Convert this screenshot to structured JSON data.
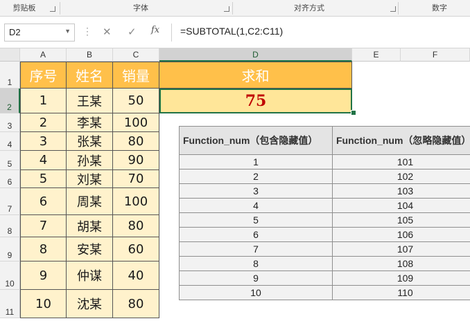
{
  "ribbon": {
    "groups": [
      "剪贴板",
      "字体",
      "对齐方式",
      "数字"
    ]
  },
  "formula_bar": {
    "name_box": "D2",
    "cancel_icon": "✕",
    "enter_icon": "✓",
    "fx_label": "fx",
    "formula": "=SUBTOTAL(1,C2:C11)"
  },
  "columns": [
    "A",
    "B",
    "C",
    "D",
    "E",
    "F"
  ],
  "rows": [
    "1",
    "2",
    "3",
    "4",
    "5",
    "6",
    "7",
    "8",
    "9",
    "10",
    "11"
  ],
  "sheet": {
    "headers": [
      "序号",
      "姓名",
      "销量"
    ],
    "records": [
      [
        "1",
        "王某",
        "50"
      ],
      [
        "2",
        "李某",
        "100"
      ],
      [
        "3",
        "张某",
        "80"
      ],
      [
        "4",
        "孙某",
        "90"
      ],
      [
        "5",
        "刘某",
        "70"
      ],
      [
        "6",
        "周某",
        "100"
      ],
      [
        "7",
        "胡某",
        "80"
      ],
      [
        "8",
        "安某",
        "60"
      ],
      [
        "9",
        "仲谋",
        "40"
      ],
      [
        "10",
        "沈某",
        "80"
      ]
    ],
    "sum_header": "求和",
    "sum_value": "75"
  },
  "reference_table": {
    "headers": [
      "Function_num（包含隐藏值）",
      "Function_num（忽略隐藏值）"
    ],
    "rows": [
      [
        "1",
        "101"
      ],
      [
        "2",
        "102"
      ],
      [
        "3",
        "103"
      ],
      [
        "4",
        "104"
      ],
      [
        "5",
        "105"
      ],
      [
        "6",
        "106"
      ],
      [
        "7",
        "107"
      ],
      [
        "8",
        "108"
      ],
      [
        "9",
        "109"
      ],
      [
        "10",
        "110"
      ]
    ]
  },
  "colors": {
    "header_fill": "#ffc04a",
    "data_fill": "#fff2cc",
    "sum_fill": "#ffe699",
    "sum_text": "#c00000",
    "selection": "#217346"
  }
}
